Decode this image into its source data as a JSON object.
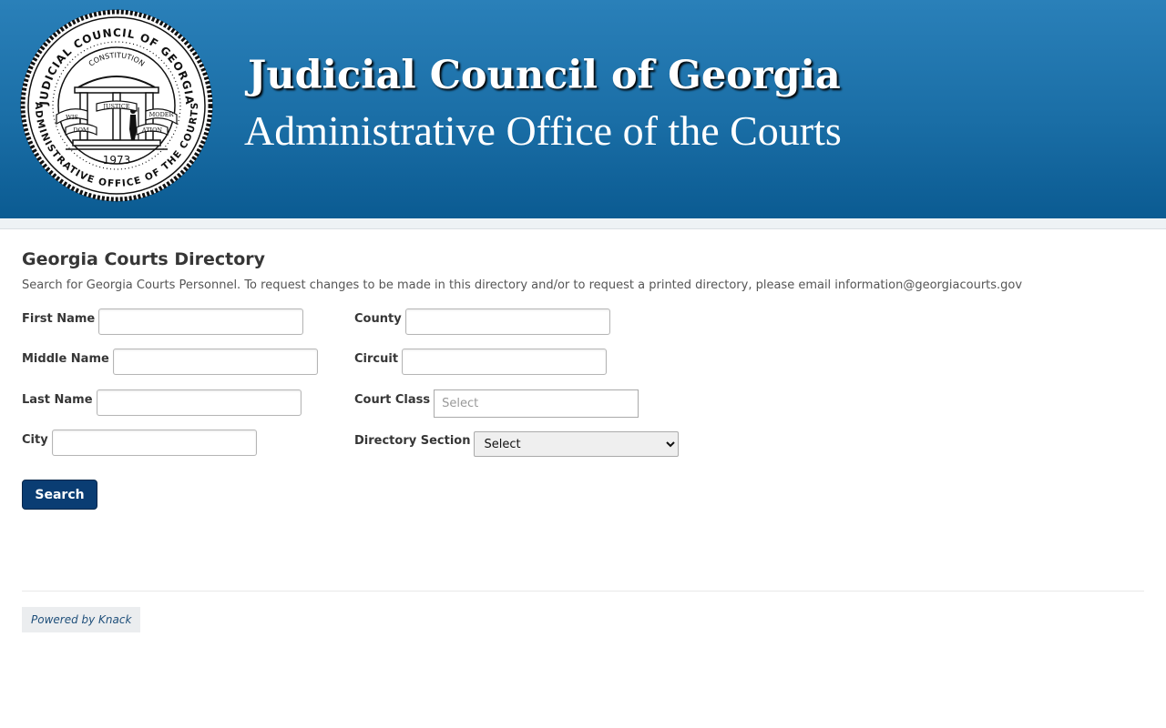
{
  "header": {
    "title": "Judicial Council of Georgia",
    "subtitle": "Administrative Office of the Courts",
    "seal": {
      "outer_text": "JUDICIAL COUNCIL OF GEORGIA",
      "bottom_text": "ADMINISTRATIVE OFFICE OF THE COURTS",
      "arch_text": "CONSTITUTION",
      "banner_left": "WIS",
      "banner_left_2": "DOM",
      "banner_center": "JUSTICE",
      "banner_right": "MODER",
      "banner_right_2": "ATION",
      "year": "1973"
    }
  },
  "main": {
    "title": "Georgia Courts Directory",
    "description": "Search for Georgia Courts Personnel. To request changes to be made in this directory and/or to request a printed directory, please email information@georgiacourts.gov"
  },
  "form": {
    "first_name": {
      "label": "First Name",
      "value": ""
    },
    "middle_name": {
      "label": "Middle Name",
      "value": ""
    },
    "last_name": {
      "label": "Last Name",
      "value": ""
    },
    "city": {
      "label": "City",
      "value": ""
    },
    "county": {
      "label": "County",
      "value": ""
    },
    "circuit": {
      "label": "Circuit",
      "value": ""
    },
    "court_class": {
      "label": "Court Class",
      "placeholder": "Select"
    },
    "directory_section": {
      "label": "Directory Section",
      "selected": "Select"
    },
    "search_label": "Search"
  },
  "footer": {
    "powered_by": "Powered by Knack"
  },
  "colors": {
    "banner_top": "#2a80b9",
    "banner_bottom": "#0b5b92",
    "button": "#0a3d73"
  }
}
